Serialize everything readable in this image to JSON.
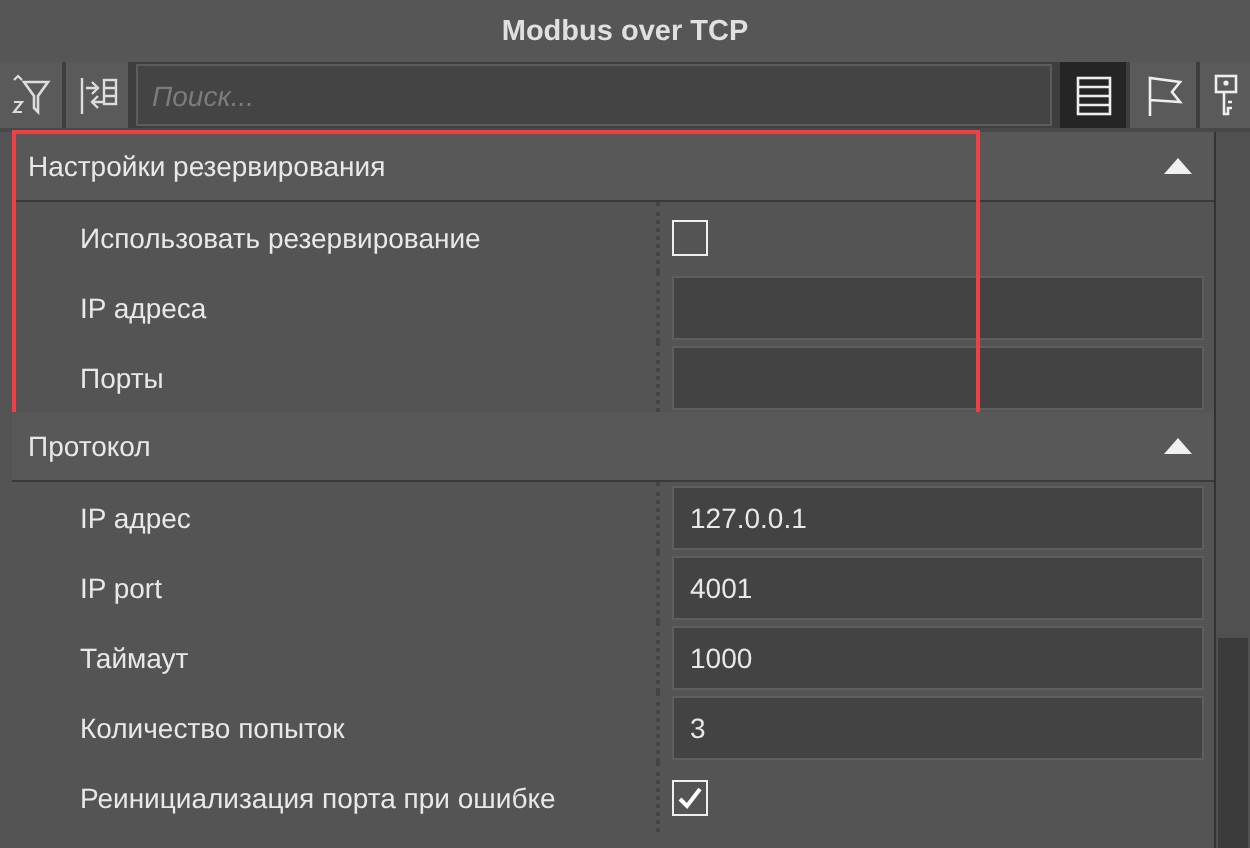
{
  "window": {
    "title": "Modbus over TCP"
  },
  "toolbar": {
    "search": {
      "placeholder": "Поиск..."
    },
    "view_buttons": [
      {
        "kind": "list",
        "selected": true
      },
      {
        "kind": "flag",
        "selected": false
      },
      {
        "kind": "key",
        "selected": false
      }
    ]
  },
  "sections": [
    {
      "title": "Настройки резервирования",
      "expanded": true,
      "highlighted": true,
      "rows": [
        {
          "label": "Использовать резервирование",
          "kind": "checkbox",
          "checked": false
        },
        {
          "label": "IP адреса",
          "kind": "text"
        },
        {
          "label": "Порты",
          "kind": "text"
        }
      ]
    },
    {
      "title": "Протокол",
      "expanded": true,
      "highlighted": false,
      "rows": [
        {
          "label": "IP адрес",
          "kind": "text",
          "value": "127.0.0.1"
        },
        {
          "label": "IP port",
          "kind": "text",
          "value": "4001"
        },
        {
          "label": "Таймаут",
          "kind": "text",
          "value": "1000"
        },
        {
          "label": "Количество попыток",
          "kind": "text",
          "value": "3"
        },
        {
          "label": "Реинициализация порта при ошибке",
          "kind": "checkbox",
          "checked": true
        }
      ]
    }
  ]
}
